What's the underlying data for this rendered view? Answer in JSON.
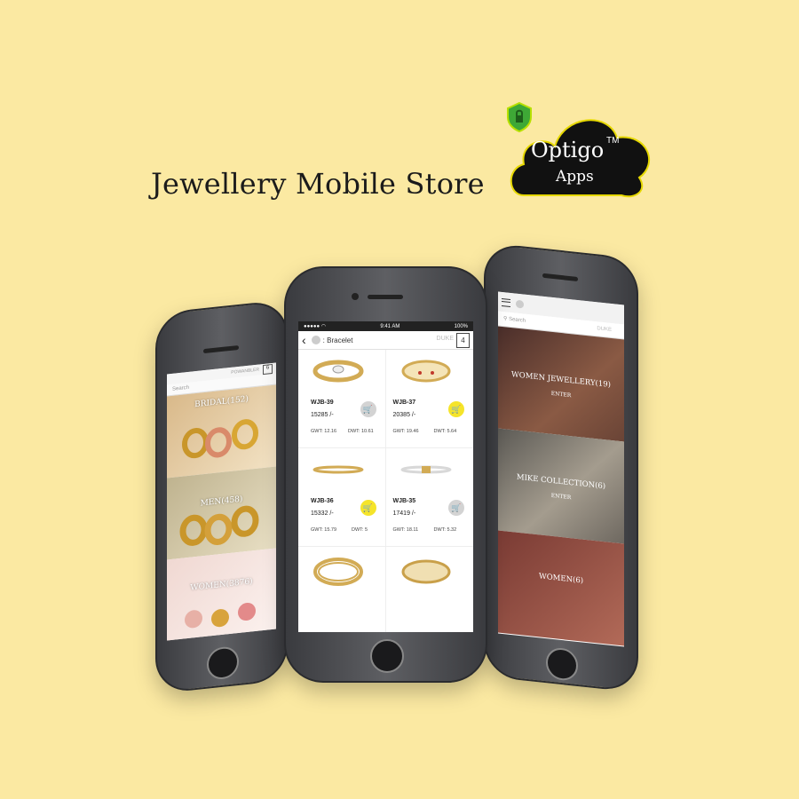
{
  "header": {
    "headline": "Jewellery Mobile Store",
    "logo_name": "Optigo",
    "logo_tm": "TM",
    "logo_apps": "Apps"
  },
  "colors": {
    "background": "#fbe9a2",
    "cart_active": "#f5e42a",
    "cart_inactive": "#d3d3d3"
  },
  "center_phone": {
    "status_time": "9:41 AM",
    "status_battery": "100%",
    "status_carrier": "●●●●● ◠",
    "title": ": Bracelet",
    "username": "DUKE",
    "cart_count": "4",
    "products": [
      {
        "code": "WJB-39",
        "price": "15285 /-",
        "gwt": "GWT: 12.16",
        "dwt": "DWT: 10.61",
        "cart_state": "grey"
      },
      {
        "code": "WJB-37",
        "price": "20385 /-",
        "gwt": "GWT: 19.46",
        "dwt": "DWT: 5.64",
        "cart_state": "yellow"
      },
      {
        "code": "WJB-36",
        "price": "15332 /-",
        "gwt": "GWT: 15.79",
        "dwt": "DWT: 5",
        "cart_state": "yellow"
      },
      {
        "code": "WJB-35",
        "price": "17419 /-",
        "gwt": "GWT: 18.11",
        "dwt": "DWT: 5.32",
        "cart_state": "grey"
      }
    ]
  },
  "left_phone": {
    "search_placeholder": "Search",
    "username": "POWANBLER",
    "cart_count": "6",
    "categories": [
      "BRIDAL(152)",
      "MEN(458)",
      "WOMEN(3876)"
    ]
  },
  "right_phone": {
    "search_placeholder": "Search",
    "username": "DUKE",
    "cart_count": "4",
    "collections": [
      {
        "label": "WOMEN JEWELLERY(19)",
        "sub": "ENTER"
      },
      {
        "label": "MIKE COLLECTION(6)",
        "sub": "ENTER"
      },
      {
        "label": "WOMEN(6)",
        "sub": ""
      }
    ]
  }
}
